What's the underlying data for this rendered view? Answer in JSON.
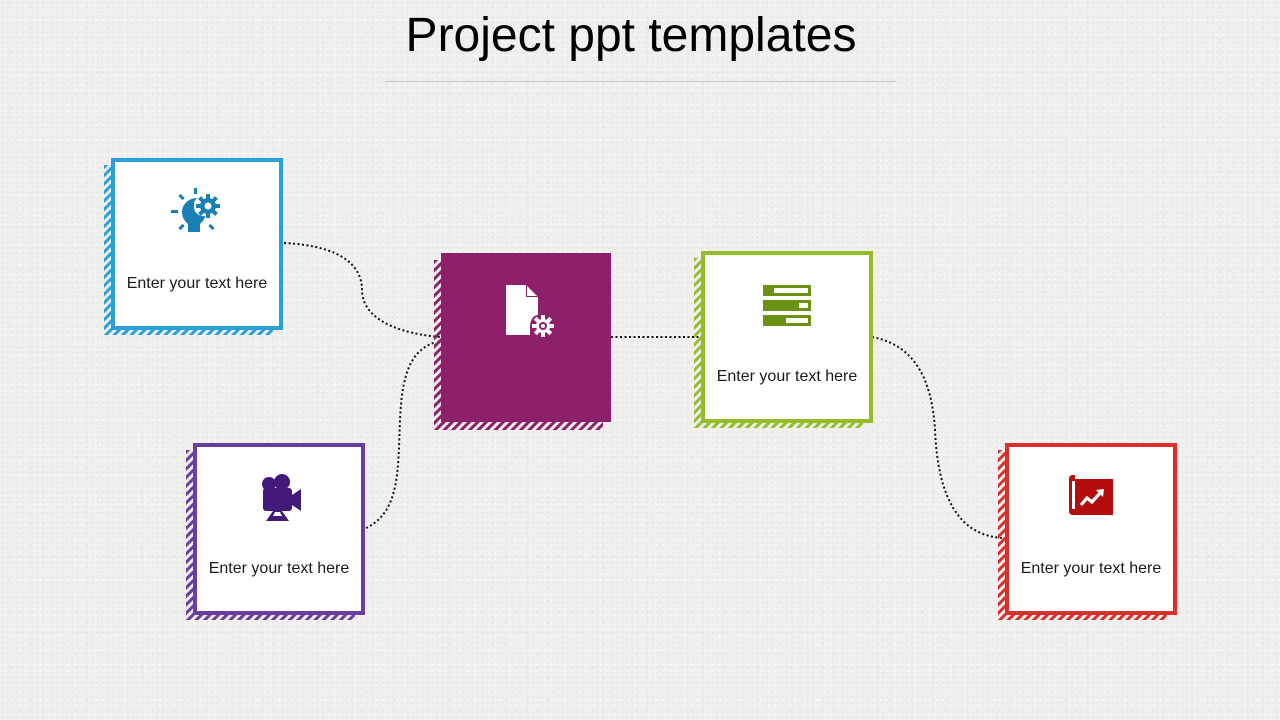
{
  "slide": {
    "title": "Project ppt templates"
  },
  "colors": {
    "blue": "#29a1d8",
    "blue_icon": "#1a7fb5",
    "purple": "#6a3da0",
    "purple_icon": "#43197a",
    "magenta": "#8e1f6b",
    "green": "#93be2a",
    "green_icon": "#6b9112",
    "red": "#d9302e",
    "red_icon": "#b50d0d",
    "connector": "#111111"
  },
  "cards": [
    {
      "id": "idea",
      "icon": "lightbulb-gear-icon",
      "text": "Enter your text here"
    },
    {
      "id": "video",
      "icon": "movie-camera-icon",
      "text": "Enter your text here"
    },
    {
      "id": "center",
      "icon": "document-settings-icon",
      "text": ""
    },
    {
      "id": "progress",
      "icon": "progress-bars-icon",
      "text": "Enter your text here"
    },
    {
      "id": "chart",
      "icon": "chart-map-icon",
      "text": "Enter your text here"
    }
  ]
}
